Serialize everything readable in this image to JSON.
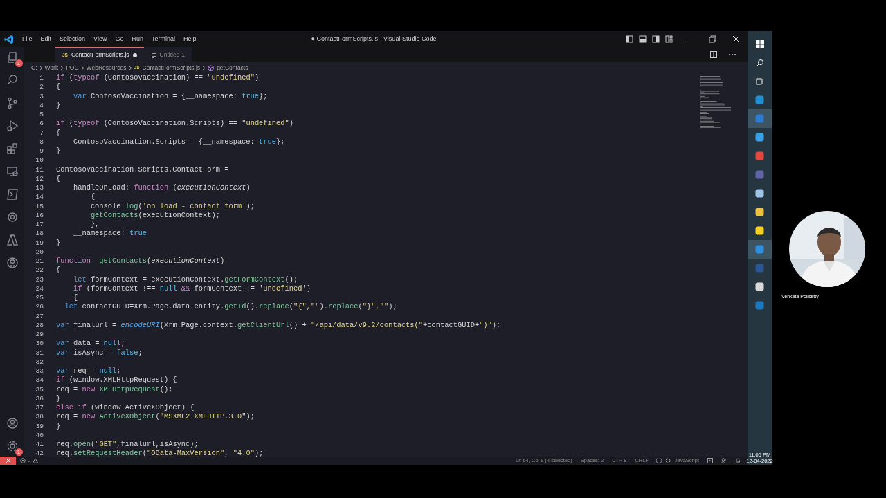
{
  "window": {
    "title": "● ContactFormScripts.js - Visual Studio Code"
  },
  "menu": [
    "File",
    "Edit",
    "Selection",
    "View",
    "Go",
    "Run",
    "Terminal",
    "Help"
  ],
  "activity_bar": {
    "explorer_badge": "1",
    "settings_badge": "1"
  },
  "tabs": [
    {
      "file_type": "JS",
      "label": "ContactFormScripts.js",
      "modified": true,
      "selected": true
    },
    {
      "label": "Untitled-1",
      "modified": false,
      "selected": false
    }
  ],
  "breadcrumb": [
    {
      "label": "C:"
    },
    {
      "label": "Work"
    },
    {
      "label": "POC"
    },
    {
      "label": "WebResources"
    },
    {
      "label": "ContactFormScripts.js",
      "file_type": "JS"
    },
    {
      "label": "getContacts",
      "kind": "symbol"
    }
  ],
  "editor": {
    "lines": [
      {
        "number": "1",
        "tokens": [
          {
            "kind": "keyword",
            "t": "if"
          },
          {
            "kind": "plain",
            "t": " ("
          },
          {
            "kind": "keyword",
            "t": "typeof"
          },
          {
            "kind": "plain",
            "t": " (ContosoVaccination) == "
          },
          {
            "kind": "string",
            "t": "\"undefined\""
          },
          {
            "kind": "plain",
            "t": ")"
          }
        ]
      },
      {
        "number": "2",
        "tokens": [
          {
            "kind": "plain",
            "t": "{"
          }
        ]
      },
      {
        "number": "3",
        "tokens": [
          {
            "kind": "declaration",
            "t": "    var"
          },
          {
            "kind": "plain",
            "t": " ContosoVaccination = {__namespace: "
          },
          {
            "kind": "constant",
            "t": "true"
          },
          {
            "kind": "plain",
            "t": "};"
          }
        ]
      },
      {
        "number": "4",
        "tokens": [
          {
            "kind": "plain",
            "t": "}"
          }
        ]
      },
      {
        "number": "5"
      },
      {
        "number": "6",
        "tokens": [
          {
            "kind": "keyword",
            "t": "if"
          },
          {
            "kind": "plain",
            "t": " ("
          },
          {
            "kind": "keyword",
            "t": "typeof"
          },
          {
            "kind": "plain",
            "t": " (ContosoVaccination.Scripts) == "
          },
          {
            "kind": "string",
            "t": "\"undefined\""
          },
          {
            "kind": "plain",
            "t": ")"
          }
        ]
      },
      {
        "number": "7",
        "tokens": [
          {
            "kind": "plain",
            "t": "{"
          }
        ]
      },
      {
        "number": "8",
        "tokens": [
          {
            "kind": "plain",
            "t": "    ContosoVaccination.Scripts = {__namespace: "
          },
          {
            "kind": "constant",
            "t": "true"
          },
          {
            "kind": "plain",
            "t": "};"
          }
        ]
      },
      {
        "number": "9",
        "tokens": [
          {
            "kind": "plain",
            "t": "}"
          }
        ]
      },
      {
        "number": "10"
      },
      {
        "number": "11",
        "tokens": [
          {
            "kind": "plain",
            "t": "ContosoVaccination.Scripts.ContactForm ="
          }
        ]
      },
      {
        "number": "12",
        "tokens": [
          {
            "kind": "plain",
            "t": "{"
          }
        ]
      },
      {
        "number": "13",
        "tokens": [
          {
            "kind": "plain",
            "t": "    handleOnLoad: "
          },
          {
            "kind": "keyword",
            "t": "function"
          },
          {
            "kind": "plain",
            "t": " ("
          },
          {
            "kind": "parameter",
            "t": "executionContext"
          },
          {
            "kind": "plain",
            "t": ")"
          }
        ]
      },
      {
        "number": "14",
        "tokens": [
          {
            "kind": "plain",
            "t": "        {"
          }
        ]
      },
      {
        "number": "15",
        "tokens": [
          {
            "kind": "plain",
            "t": "        console."
          },
          {
            "kind": "function",
            "t": "log"
          },
          {
            "kind": "plain",
            "t": "("
          },
          {
            "kind": "string",
            "t": "'on load - contact form'"
          },
          {
            "kind": "plain",
            "t": ");"
          }
        ]
      },
      {
        "number": "16",
        "tokens": [
          {
            "kind": "function",
            "t": "        getContacts"
          },
          {
            "kind": "plain",
            "t": "(executionContext);"
          }
        ]
      },
      {
        "number": "17",
        "tokens": [
          {
            "kind": "plain",
            "t": "        },"
          }
        ]
      },
      {
        "number": "18",
        "tokens": [
          {
            "kind": "plain",
            "t": "    __namespace: "
          },
          {
            "kind": "constant",
            "t": "true"
          }
        ]
      },
      {
        "number": "19",
        "tokens": [
          {
            "kind": "plain",
            "t": "}"
          }
        ]
      },
      {
        "number": "20"
      },
      {
        "number": "21",
        "tokens": [
          {
            "kind": "keyword",
            "t": "function  "
          },
          {
            "kind": "function",
            "t": "getContacts"
          },
          {
            "kind": "plain",
            "t": "("
          },
          {
            "kind": "parameter",
            "t": "executionContext"
          },
          {
            "kind": "plain",
            "t": ")"
          }
        ]
      },
      {
        "number": "22",
        "tokens": [
          {
            "kind": "plain",
            "t": "{"
          }
        ]
      },
      {
        "number": "23",
        "tokens": [
          {
            "kind": "declaration",
            "t": "    let"
          },
          {
            "kind": "plain",
            "t": " formContext = executionContext."
          },
          {
            "kind": "function",
            "t": "getFormContext"
          },
          {
            "kind": "plain",
            "t": "();"
          }
        ]
      },
      {
        "number": "24",
        "tokens": [
          {
            "kind": "keyword",
            "t": "    if"
          },
          {
            "kind": "plain",
            "t": " (formContext !== "
          },
          {
            "kind": "constant",
            "t": "null "
          },
          {
            "kind": "keyword",
            "t": "&&"
          },
          {
            "kind": "plain",
            "t": " formContext != "
          },
          {
            "kind": "string",
            "t": "'undefined'"
          },
          {
            "kind": "plain",
            "t": ")"
          }
        ]
      },
      {
        "number": "25",
        "tokens": [
          {
            "kind": "plain",
            "t": "    {"
          }
        ]
      },
      {
        "number": "26",
        "tokens": [
          {
            "kind": "declaration",
            "t": "  let"
          },
          {
            "kind": "plain",
            "t": " contactGUID=Xrm.Page.data.entity."
          },
          {
            "kind": "function",
            "t": "getId"
          },
          {
            "kind": "plain",
            "t": "()."
          },
          {
            "kind": "function",
            "t": "replace"
          },
          {
            "kind": "plain",
            "t": "("
          },
          {
            "kind": "string",
            "t": "\"{\",\"\""
          },
          {
            "kind": "plain",
            "t": ")."
          },
          {
            "kind": "function",
            "t": "replace"
          },
          {
            "kind": "plain",
            "t": "("
          },
          {
            "kind": "string",
            "t": "\"}\",\"\""
          },
          {
            "kind": "plain",
            "t": ");"
          }
        ]
      },
      {
        "number": "27"
      },
      {
        "number": "28",
        "tokens": [
          {
            "kind": "declaration",
            "t": "var"
          },
          {
            "kind": "plain",
            "t": " finalurl = "
          },
          {
            "kind": "builtin",
            "t": "encodeURI"
          },
          {
            "kind": "plain",
            "t": "(Xrm.Page.context."
          },
          {
            "kind": "function",
            "t": "getClientUrl"
          },
          {
            "kind": "plain",
            "t": "() + "
          },
          {
            "kind": "string",
            "t": "\"/api/data/v9.2/contacts(\""
          },
          {
            "kind": "plain",
            "t": "+contactGUID+"
          },
          {
            "kind": "string",
            "t": "\")\""
          },
          {
            "kind": "plain",
            "t": ");"
          }
        ]
      },
      {
        "number": "29"
      },
      {
        "number": "30",
        "tokens": [
          {
            "kind": "declaration",
            "t": "var"
          },
          {
            "kind": "plain",
            "t": " data = "
          },
          {
            "kind": "constant",
            "t": "null"
          },
          {
            "kind": "plain",
            "t": ";"
          }
        ]
      },
      {
        "number": "31",
        "tokens": [
          {
            "kind": "declaration",
            "t": "var"
          },
          {
            "kind": "plain",
            "t": " isAsync = "
          },
          {
            "kind": "constant",
            "t": "false"
          },
          {
            "kind": "plain",
            "t": ";"
          }
        ]
      },
      {
        "number": "32"
      },
      {
        "number": "33",
        "tokens": [
          {
            "kind": "declaration",
            "t": "var"
          },
          {
            "kind": "plain",
            "t": " req = "
          },
          {
            "kind": "constant",
            "t": "null"
          },
          {
            "kind": "plain",
            "t": ";"
          }
        ]
      },
      {
        "number": "34",
        "tokens": [
          {
            "kind": "keyword",
            "t": "if"
          },
          {
            "kind": "plain",
            "t": " (window.XMLHttpRequest) {"
          }
        ]
      },
      {
        "number": "35",
        "tokens": [
          {
            "kind": "plain",
            "t": "req = "
          },
          {
            "kind": "keyword",
            "t": "new "
          },
          {
            "kind": "function",
            "t": "XMLHttpRequest"
          },
          {
            "kind": "plain",
            "t": "();"
          }
        ]
      },
      {
        "number": "36",
        "tokens": [
          {
            "kind": "plain",
            "t": "}"
          }
        ]
      },
      {
        "number": "37",
        "tokens": [
          {
            "kind": "keyword",
            "t": "else if"
          },
          {
            "kind": "plain",
            "t": " (window.ActiveXObject) {"
          }
        ]
      },
      {
        "number": "38",
        "tokens": [
          {
            "kind": "plain",
            "t": "req = "
          },
          {
            "kind": "keyword",
            "t": "new "
          },
          {
            "kind": "function",
            "t": "ActiveXObject"
          },
          {
            "kind": "plain",
            "t": "("
          },
          {
            "kind": "string",
            "t": "\"MSXML2.XMLHTTP.3.0\""
          },
          {
            "kind": "plain",
            "t": ");"
          }
        ]
      },
      {
        "number": "39",
        "tokens": [
          {
            "kind": "plain",
            "t": "}"
          }
        ]
      },
      {
        "number": "40"
      },
      {
        "number": "41",
        "tokens": [
          {
            "kind": "plain",
            "t": "req."
          },
          {
            "kind": "function",
            "t": "open"
          },
          {
            "kind": "plain",
            "t": "("
          },
          {
            "kind": "string",
            "t": "\"GET\""
          },
          {
            "kind": "plain",
            "t": ",finalurl,isAsync);"
          }
        ]
      },
      {
        "number": "42",
        "tokens": [
          {
            "kind": "plain",
            "t": "req."
          },
          {
            "kind": "function",
            "t": "setRequestHeader"
          },
          {
            "kind": "plain",
            "t": "("
          },
          {
            "kind": "string",
            "t": "\"OData-MaxVersion\""
          },
          {
            "kind": "plain",
            "t": ", "
          },
          {
            "kind": "string",
            "t": "\"4.0\""
          },
          {
            "kind": "plain",
            "t": ");"
          }
        ]
      }
    ]
  },
  "status_bar": {
    "errors": "0",
    "items": [
      "Ln 64, Col 9 (4 selected)",
      "Spaces: 2",
      "UTF-8",
      "CRLF"
    ],
    "language": "JavaScript"
  },
  "taskbar": {
    "apps": [
      {
        "color": "#1f8fd6",
        "selected": false
      },
      {
        "color": "#2b7cd3",
        "selected": true
      },
      {
        "color": "#3aa0e8",
        "selected": false
      },
      {
        "color": "#e8453c",
        "selected": false
      },
      {
        "color": "#6264a7",
        "selected": false
      },
      {
        "color": "#9ec3e6",
        "selected": false
      },
      {
        "color": "#f0c040",
        "selected": false
      },
      {
        "color": "#f7d21e",
        "selected": false
      },
      {
        "color": "#2f8fe0",
        "selected": true
      },
      {
        "color": "#2b5797",
        "selected": false
      },
      {
        "color": "#d9d9d9",
        "selected": false
      },
      {
        "color": "#1c79c0",
        "selected": false
      }
    ],
    "time": "11:05 PM",
    "date": "12-04-2022"
  },
  "webcam": {
    "kind": "picture",
    "caption": "Venkata Polisetty"
  }
}
